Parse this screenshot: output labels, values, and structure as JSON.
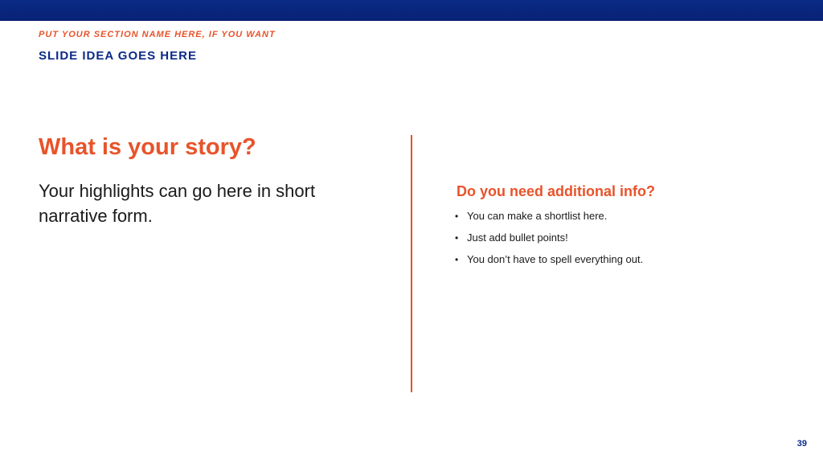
{
  "header": {
    "section_name": "PUT YOUR SECTION NAME HERE, IF YOU WANT",
    "slide_idea": "SLIDE IDEA GOES HERE"
  },
  "left": {
    "heading": "What is your story?",
    "body": "Your highlights can go here in short narrative form."
  },
  "right": {
    "heading": "Do you need additional info?",
    "bullet_symbol": "•",
    "bullets": [
      "You can make a shortlist here.",
      "Just add bullet points!",
      "You don’t have to spell everything out."
    ]
  },
  "footer": {
    "page_number": "39"
  },
  "colors": {
    "accent_orange": "#e8532a",
    "brand_blue": "#0b2a8a",
    "top_bar": "#082274"
  }
}
